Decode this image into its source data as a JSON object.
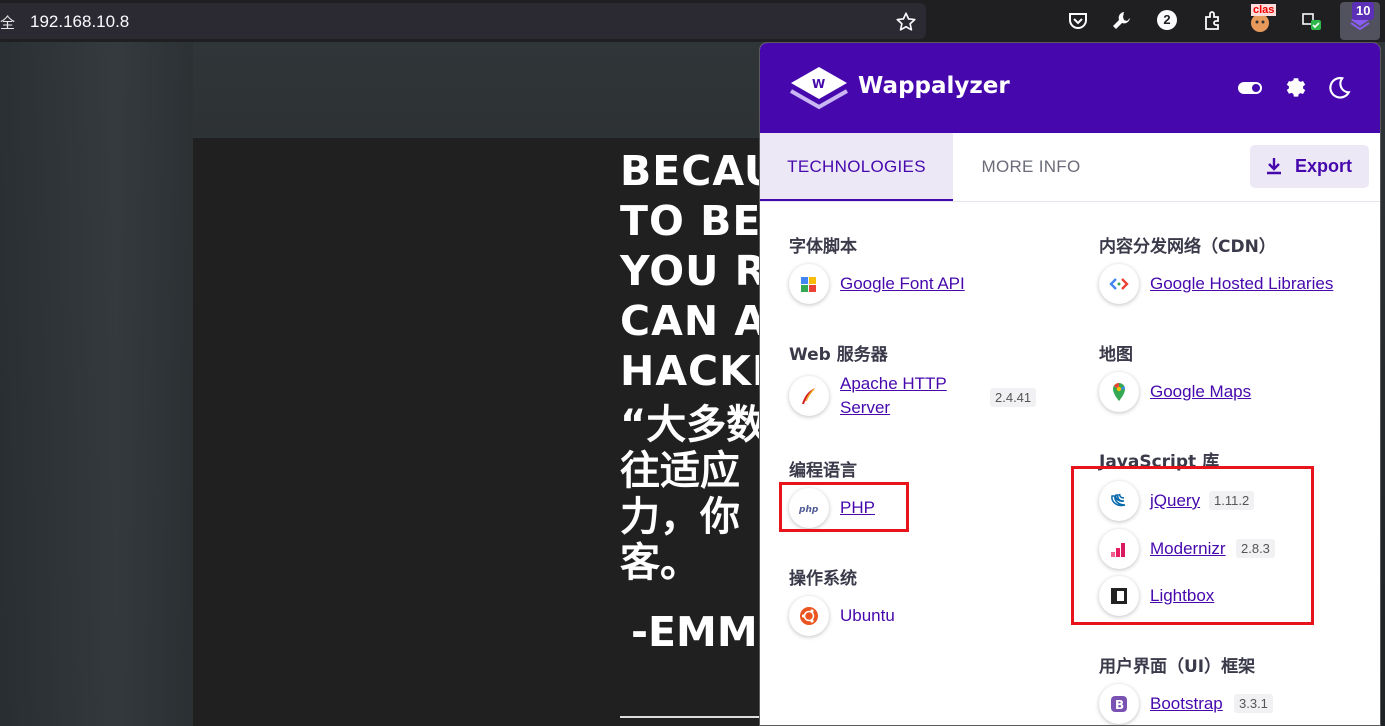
{
  "browser": {
    "url_prefix": "全",
    "url": "192.168.10.8",
    "toolbar_badge_count": "2",
    "extension_badge_count": "10",
    "ext_red_label": "clas"
  },
  "page": {
    "quote_en": [
      "BECAU",
      "TO BE",
      "YOU R",
      "CAN A",
      "HACKE"
    ],
    "quote_zh": [
      "“大多数",
      "往适应",
      "力，你",
      "客。"
    ],
    "quote_author": "-EMM"
  },
  "wappalyzer": {
    "title": "Wappalyzer",
    "tabs": [
      "TECHNOLOGIES",
      "MORE INFO"
    ],
    "export_label": "Export",
    "categories": [
      {
        "name": "字体脚本",
        "techs": [
          {
            "name": "Google Font API",
            "version": ""
          }
        ]
      },
      {
        "name": "Web 服务器",
        "techs": [
          {
            "name": "Apache HTTP Server",
            "name_lines": [
              "Apache HTTP",
              "Server"
            ],
            "version": "2.4.41"
          }
        ]
      },
      {
        "name": "编程语言",
        "techs": [
          {
            "name": "PHP",
            "version": ""
          }
        ]
      },
      {
        "name": "操作系统",
        "techs": [
          {
            "name": "Ubuntu",
            "version": ""
          }
        ]
      },
      {
        "name": "内容分发网络（CDN）",
        "techs": [
          {
            "name": "Google Hosted Libraries",
            "version": ""
          }
        ]
      },
      {
        "name": "地图",
        "techs": [
          {
            "name": "Google Maps",
            "version": ""
          }
        ]
      },
      {
        "name": "JavaScript 库",
        "techs": [
          {
            "name": "jQuery",
            "version": "1.11.2"
          },
          {
            "name": "Modernizr",
            "version": "2.8.3"
          },
          {
            "name": "Lightbox",
            "version": ""
          }
        ]
      },
      {
        "name": "用户界面（UI）框架",
        "techs": [
          {
            "name": "Bootstrap",
            "version": "3.3.1"
          }
        ]
      }
    ]
  },
  "colors": {
    "wappalyzer_purple": "#4608ad",
    "highlight_red": "#e8141c"
  },
  "icons": [
    "star-icon",
    "pocket-icon",
    "wrench-icon",
    "puzzle-icon",
    "toggle-icon",
    "gear-icon",
    "moon-icon",
    "download-icon"
  ]
}
